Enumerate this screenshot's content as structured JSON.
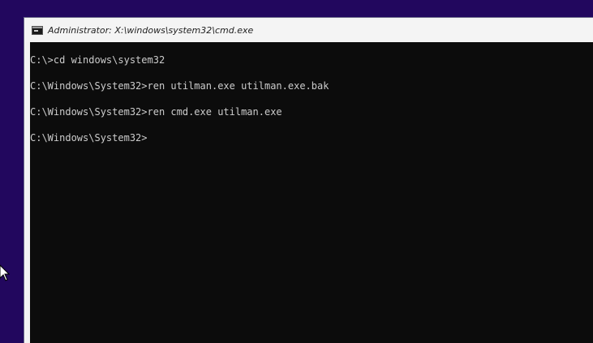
{
  "window": {
    "title": "Administrator: X:\\windows\\system32\\cmd.exe",
    "icon": "cmd-icon"
  },
  "console": {
    "lines": [
      "C:\\>cd windows\\system32",
      "C:\\Windows\\System32>ren utilman.exe utilman.exe.bak",
      "C:\\Windows\\System32>ren cmd.exe utilman.exe",
      "C:\\Windows\\System32>"
    ],
    "background": "#0c0c0c",
    "foreground": "#cccccc"
  },
  "desktop": {
    "background": "#22075e"
  },
  "cursor": {
    "icon": "mouse-pointer-icon"
  }
}
